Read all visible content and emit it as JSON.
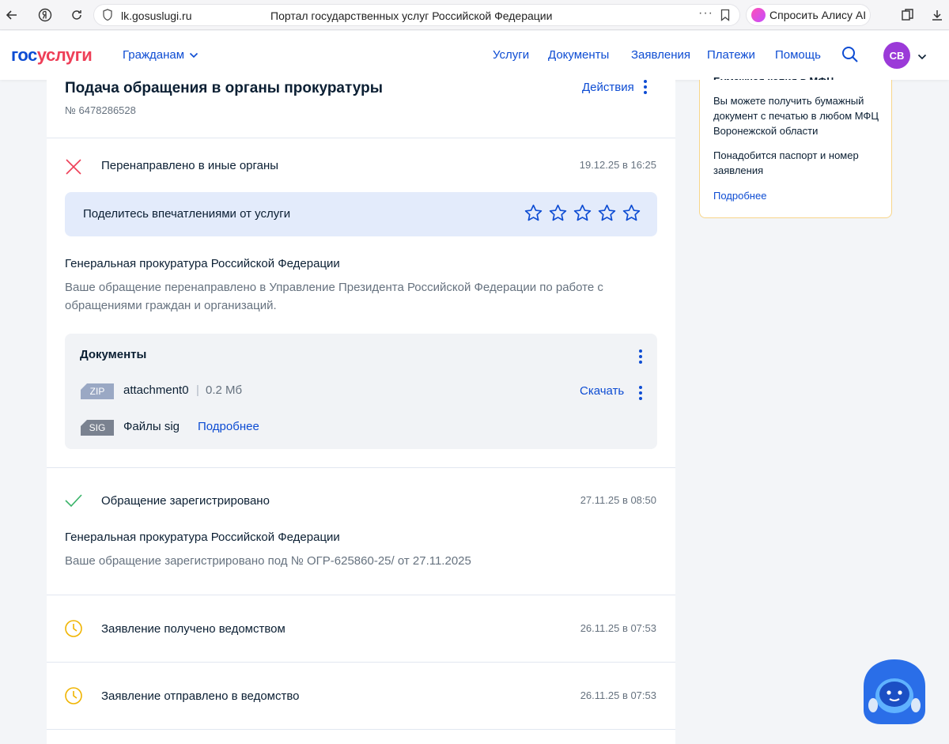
{
  "browser": {
    "url": "lk.gosuslugi.ru",
    "page_title": "Портал государственных услуг Российской Федерации",
    "alice_label": "Спросить Алису AI"
  },
  "header": {
    "logo_part1": "гос",
    "logo_part2": "услуги",
    "audience": "Гражданам",
    "nav": [
      "Услуги",
      "Документы",
      "Заявления",
      "Платежи",
      "Помощь"
    ],
    "avatar_initials": "СВ"
  },
  "request": {
    "title": "Подача обращения в органы прокуратуры",
    "number": "№ 6478286528",
    "actions_label": "Действия"
  },
  "events": [
    {
      "status": "Перенаправлено в иные органы",
      "date": "19.12.25 в 16:25",
      "feedback": "Поделитесь впечатлениями от услуги",
      "org": "Генеральная прокуратура Российской Федерации",
      "description": "Ваше обращение перенаправлено в Управление Президента Российской Федерации по работе с обращениями граждан и организаций.",
      "documents_title": "Документы",
      "files": [
        {
          "type": "ZIP",
          "name": "attachment0",
          "size": "0.2 Мб",
          "action": "Скачать"
        },
        {
          "type": "SIG",
          "name": "Файлы sig",
          "action": "Подробнее"
        }
      ]
    },
    {
      "status": "Обращение зарегистрировано",
      "date": "27.11.25 в 08:50",
      "org": "Генеральная прокуратура Российской Федерации",
      "description": "Ваше обращение зарегистрировано под № ОГР-625860-25/ от 27.11.2025"
    },
    {
      "status": "Заявление получено ведомством",
      "date": "26.11.25 в 07:53"
    },
    {
      "status": "Заявление отправлено в ведомство",
      "date": "26.11.25 в 07:53"
    }
  ],
  "side_panel": {
    "clipped_title": "Бумажная копия в МФЦ",
    "text1": "Вы можете получить бумажный документ с печатью в любом МФЦ Воронежской области",
    "text2": "Понадобится паспорт и номер заявления",
    "link": "Подробнее"
  },
  "colors": {
    "brand_blue": "#0d4cd3",
    "brand_red": "#ee3f58",
    "success": "#38b368",
    "error": "#ee3f58",
    "pending": "#f0b400"
  }
}
